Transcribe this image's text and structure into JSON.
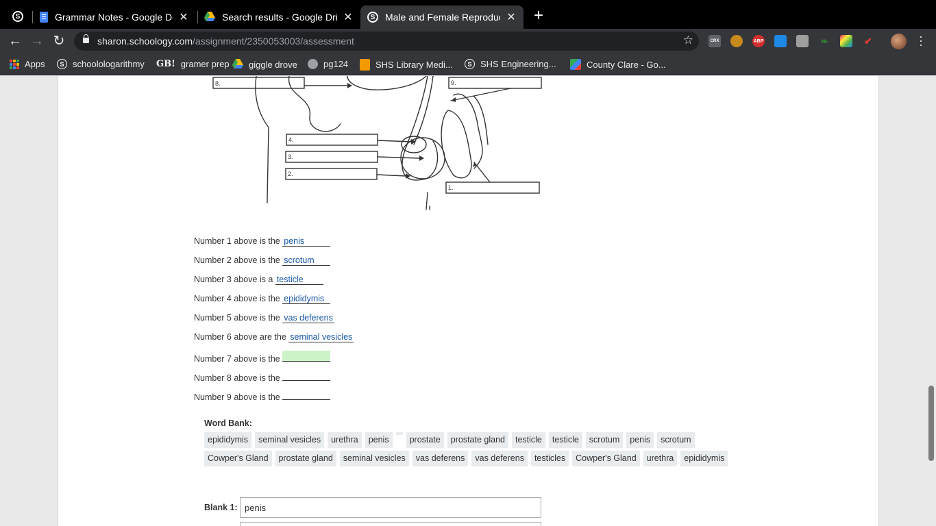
{
  "tabs": [
    {
      "title": "Grammar Notes - Google Docs",
      "icon": "google-docs-icon"
    },
    {
      "title": "Search results - Google Drive",
      "icon": "google-drive-icon"
    },
    {
      "title": "Male and Female Reproductive",
      "icon": "schoology-icon",
      "active": true
    }
  ],
  "tab_close": "✕",
  "new_tab": "+",
  "address_bar": {
    "host": "sharon.schoology.com",
    "path": "/assignment/2350053003/assessment"
  },
  "extensions": {
    "crx": "CRX",
    "abp": "ABP"
  },
  "bookmarks": [
    {
      "label": "Apps",
      "icon": "apps-grid-icon"
    },
    {
      "label": "schoolologarithmy",
      "icon": "schoology-icon"
    },
    {
      "label": "gramer prep",
      "icon": "gb-icon",
      "icon_text": "GB!"
    },
    {
      "label": "giggle drove",
      "icon": "google-drive-icon"
    },
    {
      "label": "pg124",
      "icon": "globe-icon"
    },
    {
      "label": "SHS Library Medi...",
      "icon": "library-icon"
    },
    {
      "label": "SHS Engineering...",
      "icon": "schoology-icon"
    },
    {
      "label": "County Clare - Go...",
      "icon": "google-maps-icon"
    }
  ],
  "diagram_labels": [
    "8.",
    "9.",
    "4.",
    "3.",
    "2.",
    "1."
  ],
  "questions": [
    {
      "prefix": "Number 1 above is the",
      "answer": "penis"
    },
    {
      "prefix": "Number 2 above is the",
      "answer": "scrotum"
    },
    {
      "prefix": "Number 3 above is a",
      "answer": "testicle"
    },
    {
      "prefix": "Number 4 above is the",
      "answer": "epididymis"
    },
    {
      "prefix": "Number 5 above is the",
      "answer": "vas deferens"
    },
    {
      "prefix": "Number 6 above are the",
      "answer": "seminal vesicles"
    },
    {
      "prefix": "Number 7 above is the",
      "answer": ""
    },
    {
      "prefix": "Number 8 above is the",
      "answer": ""
    },
    {
      "prefix": "Number 9 above is the",
      "answer": ""
    }
  ],
  "word_bank": {
    "title": "Word Bank:",
    "row1": [
      "epididymis",
      "seminal vesicles",
      "urethra",
      "penis",
      "",
      "prostate",
      "prostate gland",
      "testicle",
      "testicle",
      "scrotum",
      "penis",
      "scrotum"
    ],
    "row2": [
      "Cowper's Gland",
      "prostate gland",
      "seminal vesicles",
      "vas deferens",
      "vas deferens",
      "testicles",
      "Cowper's Gland",
      "urethra",
      "epididymis"
    ]
  },
  "blank1": {
    "label": "Blank 1:",
    "value": "penis"
  },
  "colors": {
    "accent_link": "#1a59a6",
    "highlight": "#ccf3c7"
  }
}
